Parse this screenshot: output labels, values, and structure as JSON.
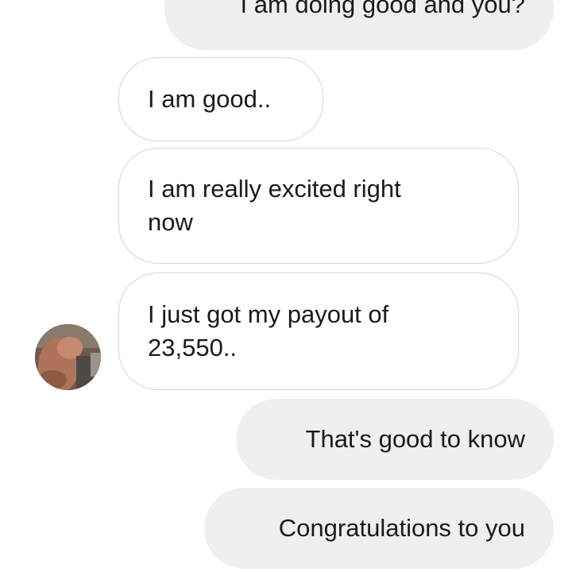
{
  "conversation": {
    "messages": [
      {
        "direction": "outgoing",
        "text": "I am doing good and you?"
      },
      {
        "direction": "incoming",
        "text": "I am good.."
      },
      {
        "direction": "incoming",
        "text": "I am really excited right\nnow"
      },
      {
        "direction": "incoming",
        "text": "I just got my payout of\n23,550.."
      },
      {
        "direction": "outgoing",
        "text": "That's good to know"
      },
      {
        "direction": "outgoing",
        "text": "Congratulations to you"
      }
    ]
  },
  "colors": {
    "outgoing_bubble": "#efefef",
    "incoming_bubble_border": "#d4d4d4",
    "background": "#ffffff"
  },
  "icons": {
    "sender_avatar": "avatar-photo"
  }
}
